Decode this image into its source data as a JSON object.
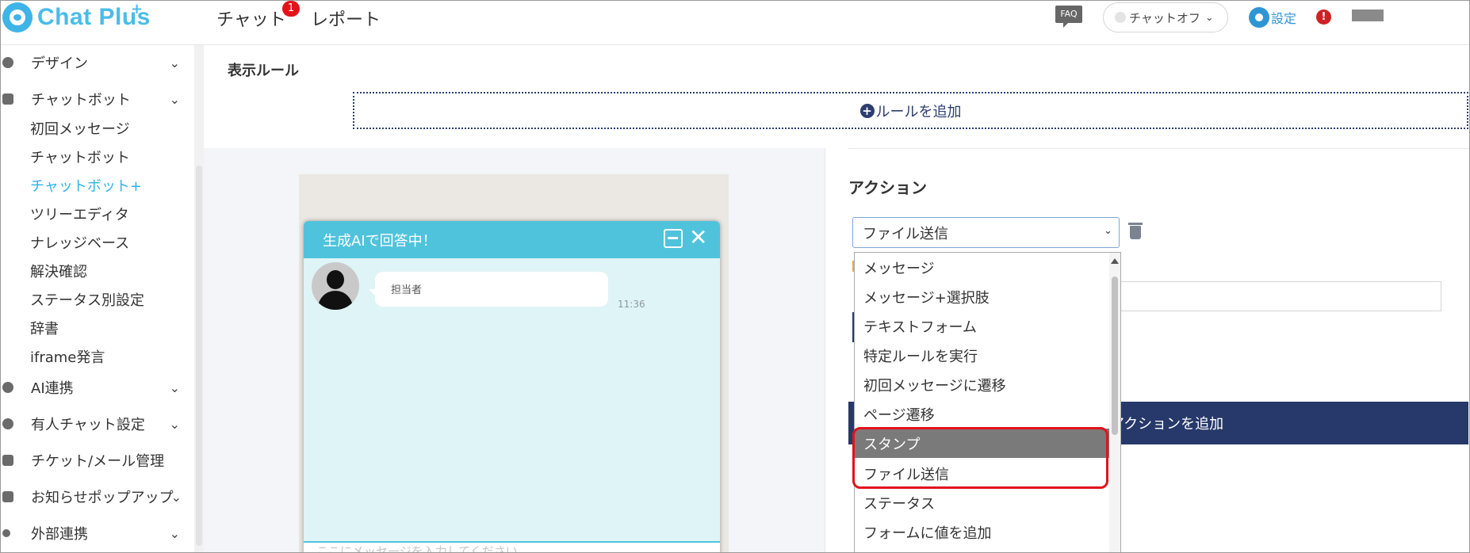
{
  "header": {
    "logo_text": "Chat Plus",
    "logo_plus": "+",
    "nav": [
      {
        "label": "チャット",
        "badge": "1"
      },
      {
        "label": "レポート"
      }
    ],
    "faq_label": "FAQ",
    "chat_toggle_label": "チャットオフ",
    "settings_label": "設定",
    "alert_label": "!"
  },
  "sidebar": {
    "items": [
      {
        "label": "デザイン",
        "chevron": "⌄",
        "icon": "palette-icon"
      },
      {
        "label": "チャットボット",
        "chevron": "⌄",
        "icon": "chat-bubbles-icon"
      },
      {
        "label": "AI連携",
        "chevron": "⌄",
        "icon": "bulb-icon"
      },
      {
        "label": "有人チャット設定",
        "chevron": "⌄",
        "icon": "headset-icon"
      },
      {
        "label": "チケット/メール管理",
        "icon": "ticket-icon"
      },
      {
        "label": "お知らせポップアップ",
        "chevron": "⌄",
        "icon": "popup-icon"
      },
      {
        "label": "外部連携",
        "chevron": "⌄",
        "icon": "share-icon"
      }
    ],
    "sub_items": [
      {
        "label": "初回メッセージ"
      },
      {
        "label": "チャットボット"
      },
      {
        "label": "チャットボット+",
        "active": true
      },
      {
        "label": "ツリーエディタ"
      },
      {
        "label": "ナレッジベース"
      },
      {
        "label": "解決確認"
      },
      {
        "label": "ステータス別設定"
      },
      {
        "label": "辞書"
      },
      {
        "label": "iframe発言"
      }
    ]
  },
  "main": {
    "section_title": "表示ルール",
    "add_rule_label": "ルールを追加",
    "preview": {
      "chat_title": "生成AIで回答中！",
      "agent_name": "担当者",
      "time": "11:36",
      "input_placeholder": "ここにメッセージを入力してください"
    },
    "action_title": "アクション",
    "selected_action": "ファイル送信",
    "add_action_label": "アクションを追加",
    "dropdown_options": [
      {
        "label": "メッセージ"
      },
      {
        "label": "メッセージ+選択肢"
      },
      {
        "label": "テキストフォーム"
      },
      {
        "label": "特定ルールを実行"
      },
      {
        "label": "初回メッセージに遷移"
      },
      {
        "label": "ページ遷移"
      },
      {
        "label": "スタンプ",
        "highlighted": true
      },
      {
        "label": "ファイル送信"
      },
      {
        "label": "ステータス"
      },
      {
        "label": "フォームに値を追加"
      }
    ]
  },
  "colors": {
    "brand": "#4abce8",
    "navy": "#27396a",
    "chat_header": "#4fc3dc",
    "highlight_box": "#e2131b"
  }
}
